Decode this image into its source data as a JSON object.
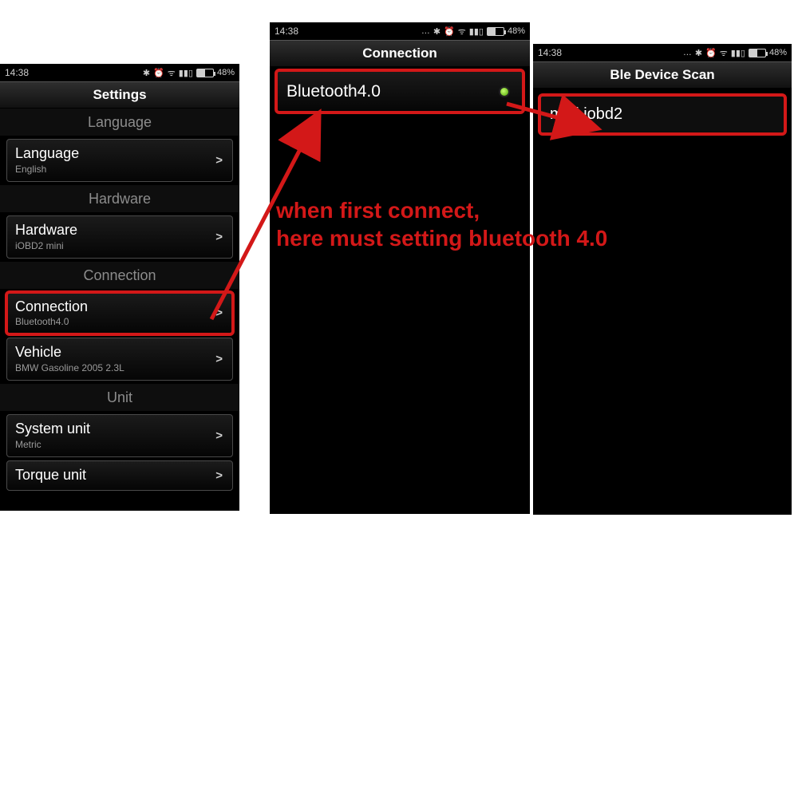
{
  "status": {
    "time": "14:38",
    "battery": "48%",
    "icons_alt": "… ✱ ⏰ 📶 ᯤ"
  },
  "phone1": {
    "title": "Settings",
    "sections": {
      "language": "Language",
      "hardware": "Hardware",
      "connection": "Connection",
      "unit": "Unit"
    },
    "rows": {
      "language": {
        "title": "Language",
        "sub": "English"
      },
      "hardware": {
        "title": "Hardware",
        "sub": "iOBD2 mini"
      },
      "connection": {
        "title": "Connection",
        "sub": "Bluetooth4.0"
      },
      "vehicle": {
        "title": "Vehicle",
        "sub": "BMW  Gasoline  2005  2.3L"
      },
      "systemunit": {
        "title": "System unit",
        "sub": "Metric"
      },
      "torqueunit": {
        "title": "Torque unit",
        "sub": ""
      }
    },
    "chev": ">"
  },
  "phone2": {
    "title": "Connection",
    "row": {
      "title": "Bluetooth4.0"
    }
  },
  "phone3": {
    "title": "Ble Device Scan",
    "row": {
      "title": "mini iobd2"
    }
  },
  "annotation": {
    "line1": "when first connect,",
    "line2": "here must setting bluetooth 4.0"
  }
}
